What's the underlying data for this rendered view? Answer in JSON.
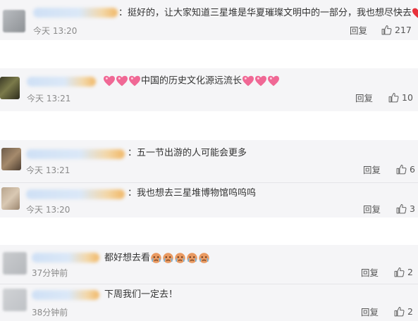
{
  "comments": [
    {
      "text": "：挺好的，让大家知道三星堆是华夏璀璨文明中的一部分，我也想尽快去",
      "time": "今天 13:20",
      "reply": "回复",
      "likes": "217"
    },
    {
      "text": "中国的历史文化源远流长",
      "time": "今天 13:21",
      "reply": "回复",
      "likes": "10"
    },
    {
      "text": "：五一节出游的人可能会更多",
      "time": "今天 13:21",
      "reply": "回复",
      "likes": "6"
    },
    {
      "text": "：我也想去三星堆博物馆呜呜呜",
      "time": "今天 13:20",
      "reply": "回复",
      "likes": "3"
    },
    {
      "text": "都好想去看",
      "time": "37分钟前",
      "reply": "回复",
      "likes": "2"
    },
    {
      "text": "下周我们一定去！",
      "time": "38分钟前",
      "reply": "回复",
      "likes": "2"
    }
  ],
  "icons": {
    "like": "thumbs-up-icon",
    "heart": "red-heart-icon",
    "sparkle_heart": "sparkling-heart-icon",
    "face": "crying-face-icon"
  },
  "colors": {
    "block_bg": "#f5f5f7",
    "text": "#333333",
    "meta": "#8a8a8a",
    "heart": "#e8323c"
  }
}
